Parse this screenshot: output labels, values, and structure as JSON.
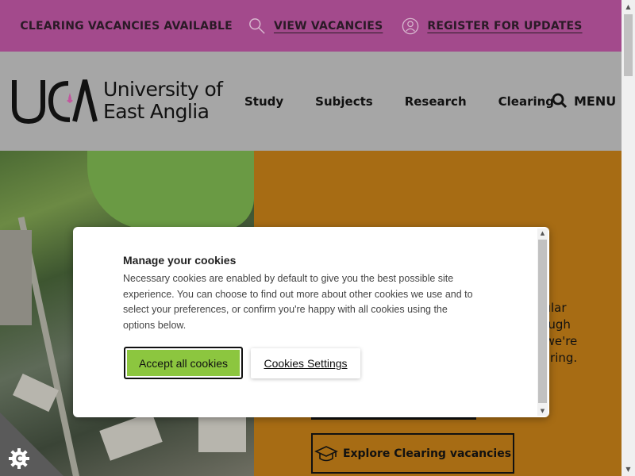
{
  "topbar": {
    "clearing_label": "CLEARING VACANCIES AVAILABLE",
    "view_vacancies": "VIEW VACANCIES",
    "register_updates": "REGISTER FOR UPDATES"
  },
  "header": {
    "logo_line1": "University of",
    "logo_line2": "East Anglia",
    "nav": [
      "Study",
      "Subjects",
      "Research",
      "Clearing"
    ],
    "menu_label": "MENU"
  },
  "hero": {
    "text_lines": [
      "rticular",
      "through",
      "es, we're",
      "Clearing."
    ],
    "explore_button": "Explore Clearing vacancies"
  },
  "cookie_dialog": {
    "title": "Manage your cookies",
    "body": "Necessary cookies are enabled by default to give you the best possible site experience. You can choose to find out more about other cookies we use and to select your preferences, or confirm you're happy with all cookies using the options below.",
    "accept_button": "Accept all cookies",
    "settings_button": "Cookies Settings"
  },
  "colors": {
    "topbar": "#a34a8c",
    "header": "#a6a6a6",
    "hero_panel": "#a76c14",
    "accept_green": "#8cc63f"
  }
}
